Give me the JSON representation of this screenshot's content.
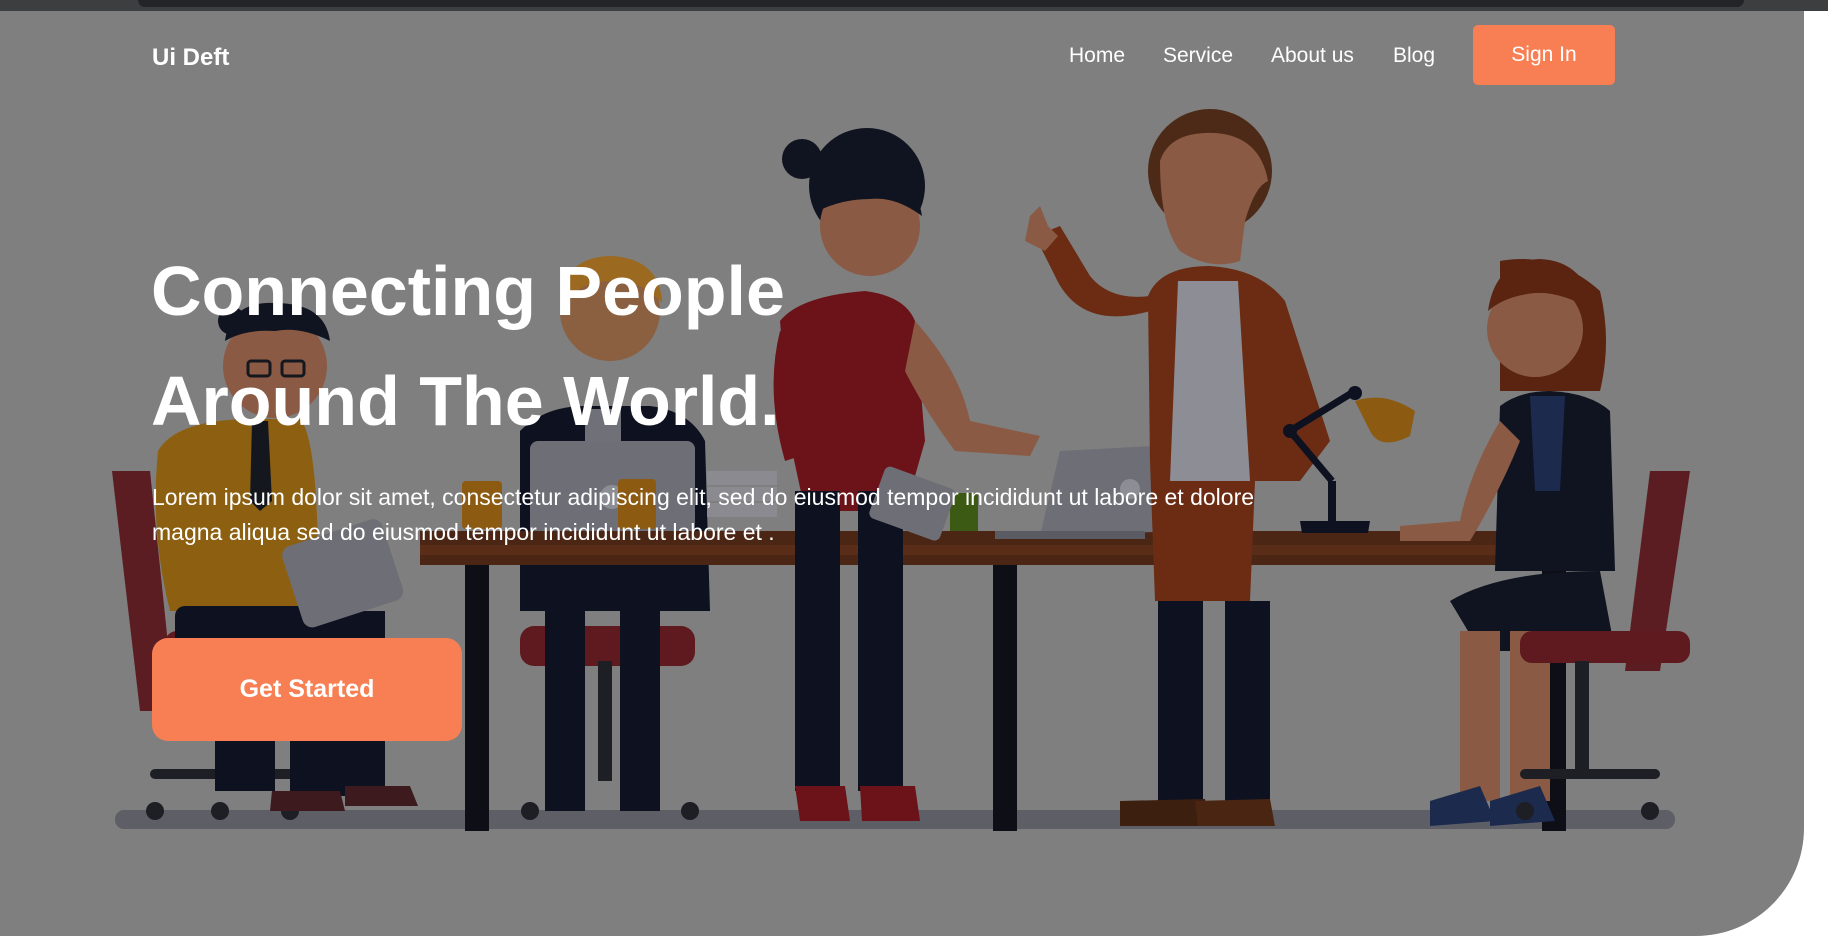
{
  "brand": {
    "name": "Ui Deft"
  },
  "nav": {
    "links": [
      "Home",
      "Service",
      "About us",
      "Blog"
    ],
    "signin_label": "Sign In"
  },
  "hero": {
    "headline_line1": "Connecting People",
    "headline_line2": "Around The World.",
    "description": "Lorem ipsum dolor sit amet, consectetur adipiscing elit, sed do eiusmod tempor incididunt ut labore et dolore magna aliqua sed do eiusmod tempor incididunt ut labore et .",
    "cta_label": "Get Started"
  },
  "colors": {
    "accent": "#f77f53",
    "overlay": "#7f7f7f",
    "text": "#ffffff"
  },
  "illustration": {
    "subject": "team-meeting-illustration"
  }
}
